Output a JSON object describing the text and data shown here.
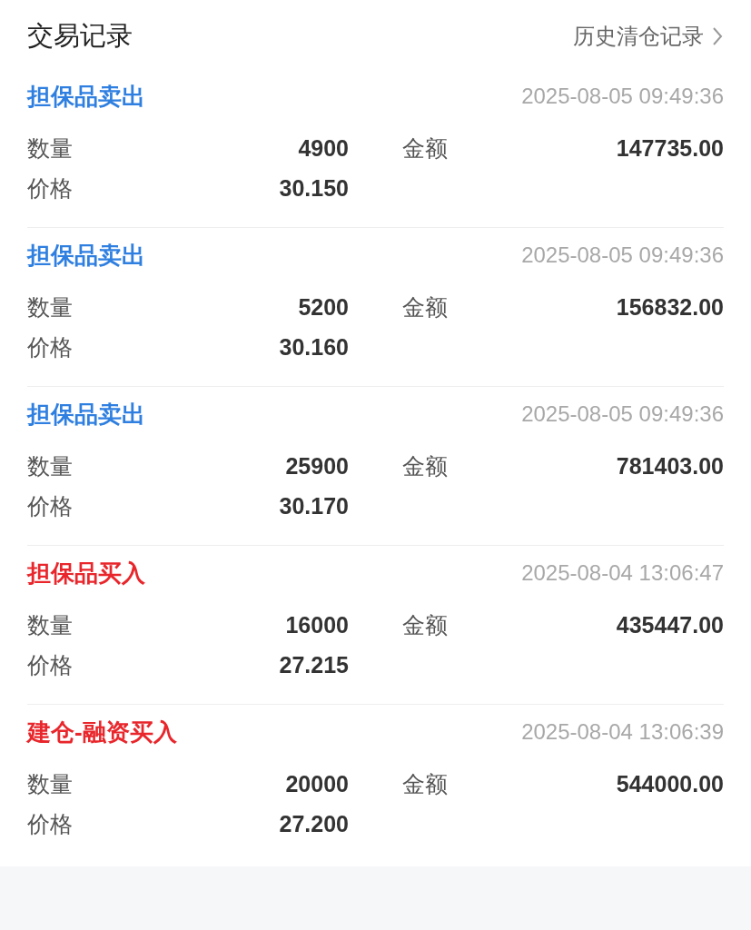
{
  "header": {
    "title": "交易记录",
    "link": "历史清仓记录"
  },
  "records": [
    {
      "type": "担保品卖出",
      "kind": "sell",
      "time": "2025-08-05 09:49:36",
      "quantity_label": "数量",
      "quantity": "4900",
      "amount_label": "金额",
      "amount": "147735.00",
      "price_label": "价格",
      "price": "30.150"
    },
    {
      "type": "担保品卖出",
      "kind": "sell",
      "time": "2025-08-05 09:49:36",
      "quantity_label": "数量",
      "quantity": "5200",
      "amount_label": "金额",
      "amount": "156832.00",
      "price_label": "价格",
      "price": "30.160"
    },
    {
      "type": "担保品卖出",
      "kind": "sell",
      "time": "2025-08-05 09:49:36",
      "quantity_label": "数量",
      "quantity": "25900",
      "amount_label": "金额",
      "amount": "781403.00",
      "price_label": "价格",
      "price": "30.170"
    },
    {
      "type": "担保品买入",
      "kind": "buy",
      "time": "2025-08-04 13:06:47",
      "quantity_label": "数量",
      "quantity": "16000",
      "amount_label": "金额",
      "amount": "435447.00",
      "price_label": "价格",
      "price": "27.215"
    },
    {
      "type": "建仓-融资买入",
      "kind": "buy",
      "time": "2025-08-04 13:06:39",
      "quantity_label": "数量",
      "quantity": "20000",
      "amount_label": "金额",
      "amount": "544000.00",
      "price_label": "价格",
      "price": "27.200"
    }
  ]
}
